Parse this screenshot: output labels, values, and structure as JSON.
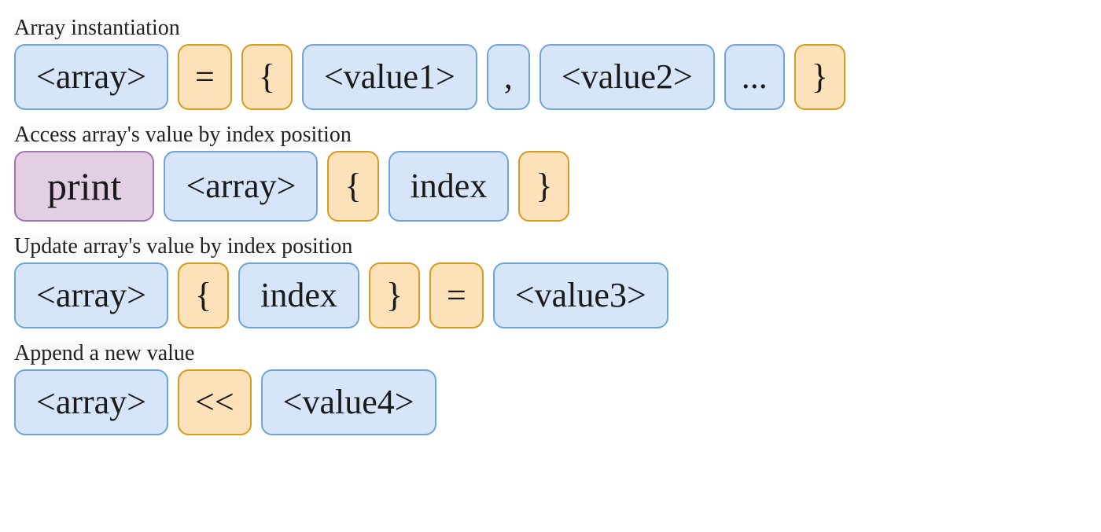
{
  "sections": {
    "instantiation": {
      "label": "Array instantiation",
      "tokens": {
        "array": "<array>",
        "equals": "=",
        "lbrace": "{",
        "value1": "<value1>",
        "comma": ",",
        "value2": "<value2>",
        "ellipsis": "...",
        "rbrace": "}"
      }
    },
    "access": {
      "label": "Access array's value by index position",
      "tokens": {
        "print": "print",
        "array": "<array>",
        "lbrace": "{",
        "index": "index",
        "rbrace": "}"
      }
    },
    "update": {
      "label": "Update array's value by index position",
      "tokens": {
        "array": "<array>",
        "lbrace": "{",
        "index": "index",
        "rbrace": "}",
        "equals": "=",
        "value3": "<value3>"
      }
    },
    "append": {
      "label": "Append a new value",
      "tokens": {
        "array": "<array>",
        "push": "<<",
        "value4": "<value4>"
      }
    }
  }
}
